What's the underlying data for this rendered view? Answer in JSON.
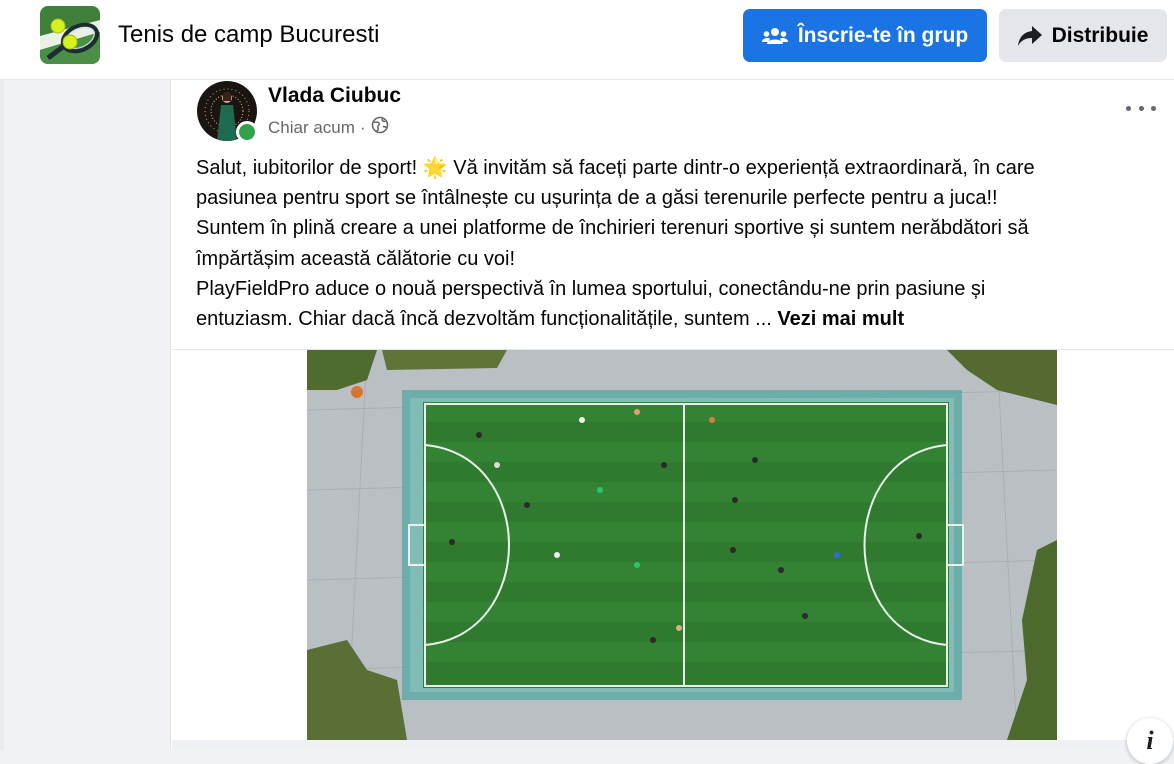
{
  "group": {
    "name": "Tenis de camp Bucuresti",
    "thumbnail_icon": "tennis-racket-and-balls-icon"
  },
  "header_buttons": {
    "join_label": "Înscrie-te în grup",
    "share_label": "Distribuie",
    "join_color": "#1b74e4",
    "share_color": "#e4e6eb"
  },
  "post": {
    "author": "Vlada Ciubuc",
    "time": "Chiar acum",
    "separator": "·",
    "audience_icon": "globe-icon",
    "online_color": "#31a24c",
    "lines": [
      "Salut, iubitorilor de sport! 🌟 Vă invităm să faceți parte dintr-o experiență extraordinară, în care",
      "pasiunea pentru sport se întâlnește cu ușurința de a găsi terenurile perfecte pentru a juca!!",
      "Suntem în plină creare a unei platforme  de închirieri terenuri sportive și suntem nerăbdători să",
      "împărtășim această călătorie cu voi!",
      "PlayFieldPro aduce o nouă perspectivă în lumea sportului, conectându-ne prin pasiune și"
    ],
    "last_line": "entuziasm. Chiar dacă încă dezvoltăm funcționalitățile, suntem ...",
    "see_more": "Vezi mai mult",
    "photo": "aerial-football-pitch-photo"
  }
}
